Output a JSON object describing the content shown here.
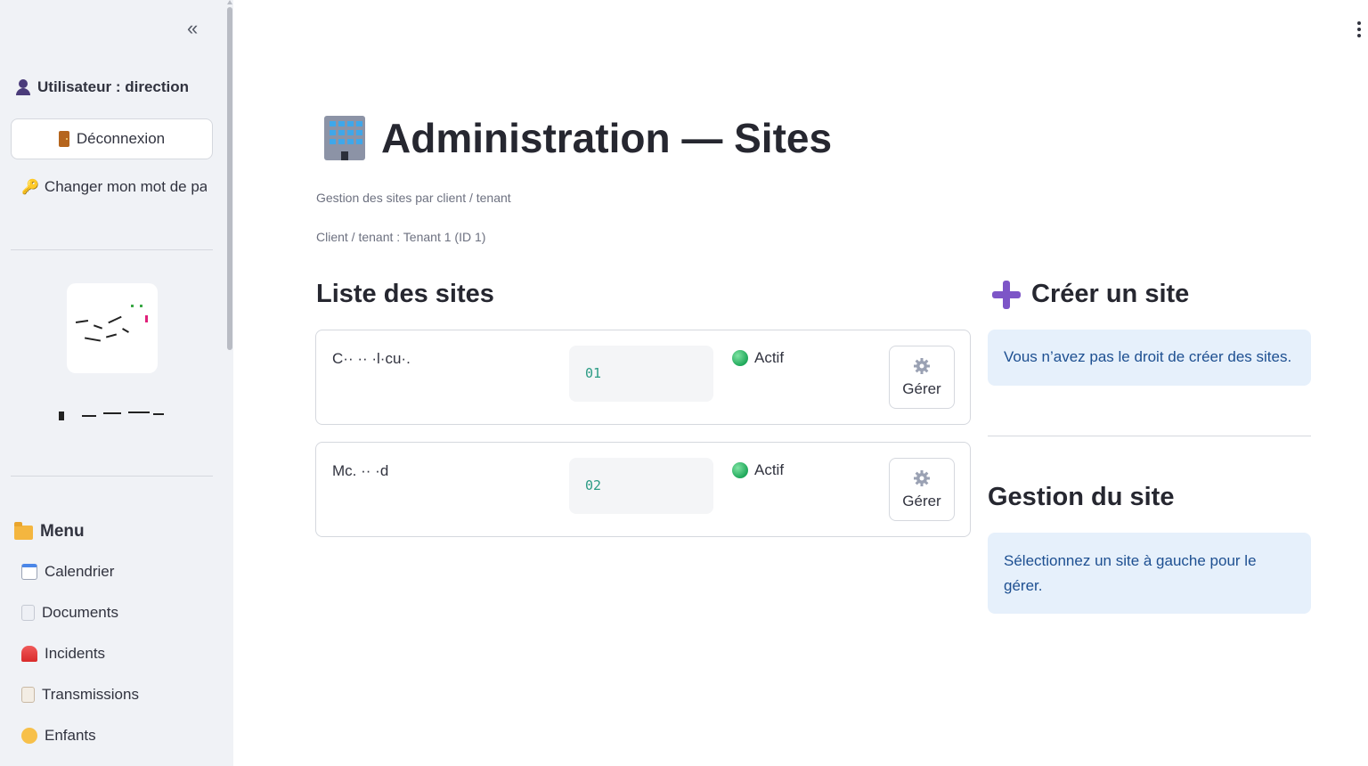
{
  "sidebar": {
    "user_label": "Utilisateur : direction",
    "logout_label": "Déconnexion",
    "change_password_label": "Changer mon mot de pa",
    "menu_title": "Menu",
    "menu_items": [
      {
        "label": "Calendrier",
        "icon": "calendar-icon"
      },
      {
        "label": "Documents",
        "icon": "document-icon"
      },
      {
        "label": "Incidents",
        "icon": "siren-icon"
      },
      {
        "label": "Transmissions",
        "icon": "memo-icon"
      },
      {
        "label": "Enfants",
        "icon": "child-icon"
      }
    ]
  },
  "main": {
    "title": "Administration — Sites",
    "subtitle": "Gestion des sites par client / tenant",
    "tenant_line": "Client / tenant : Tenant 1 (ID 1)",
    "list_heading": "Liste des sites",
    "sites": [
      {
        "name": "C·· ·· ·l·cu·.",
        "code": "01",
        "status": "Actif",
        "action": "Gérer"
      },
      {
        "name": "Mc. ·· ·d",
        "code": "02",
        "status": "Actif",
        "action": "Gérer"
      }
    ],
    "create_heading": "Créer un site",
    "create_info": "Vous n’avez pas le droit de créer des sites.",
    "manage_heading": "Gestion du site",
    "manage_info": "Sélectionnez un site à gauche pour le gérer."
  },
  "colors": {
    "accent_plus": "#7d55c7",
    "info_bg": "#e6f0fb",
    "info_text": "#1d4f91",
    "status_green": "#1fa85a",
    "code_text": "#2b9b84"
  }
}
